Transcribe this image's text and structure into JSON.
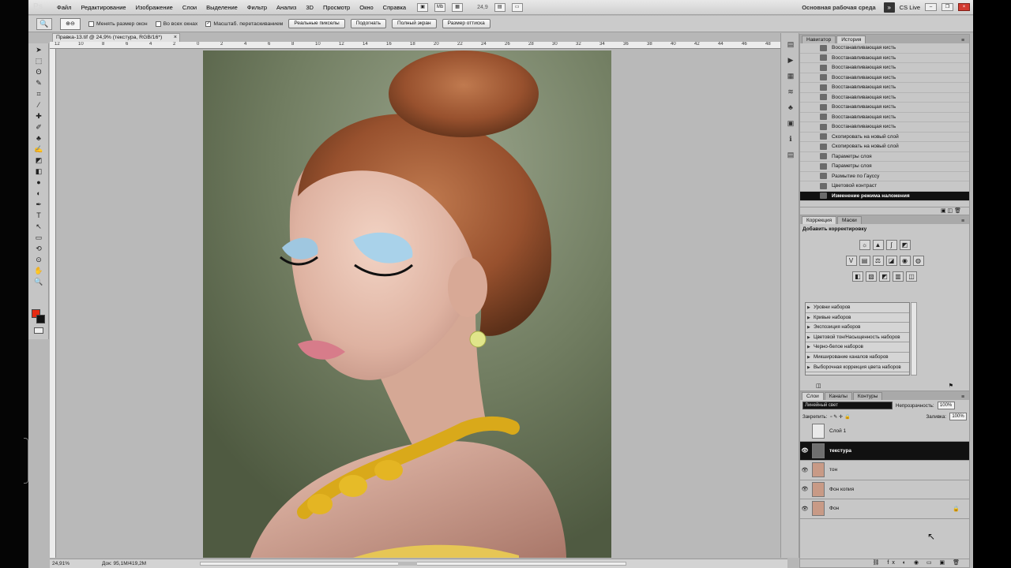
{
  "menubar": {
    "logo": "Ps",
    "items": [
      "Файл",
      "Редактирование",
      "Изображение",
      "Слои",
      "Выделение",
      "Фильтр",
      "Анализ",
      "3D",
      "Просмотр",
      "Окно",
      "Справка"
    ],
    "icons": [
      "mb-icon",
      "mb-icon"
    ],
    "zoom": "24,9",
    "workspace": "Основная рабочая среда",
    "workspace_btn": "»",
    "cs_live": "CS Live"
  },
  "options": {
    "tool_icon": "🔍",
    "zoom_icon": "⊕⊖",
    "checkboxes": [
      {
        "label": "Менять размер окон",
        "checked": false
      },
      {
        "label": "Во всех окнах",
        "checked": false
      },
      {
        "label": "Масштаб. перетаскиванием",
        "checked": true
      }
    ],
    "buttons": [
      "Реальные пикселы",
      "Подогнать",
      "Полный экран",
      "Размер оттиска"
    ]
  },
  "document": {
    "tab_title": "Правка-13.tif @ 24,9% (текстура, RGB/16*)",
    "tab_close": "×",
    "ruler_ticks": [
      "12",
      "10",
      "8",
      "6",
      "4",
      "2",
      "0",
      "2",
      "4",
      "6",
      "8",
      "10",
      "12",
      "14",
      "16",
      "18",
      "20",
      "22",
      "24",
      "26",
      "28",
      "30",
      "32",
      "34",
      "36",
      "38",
      "40",
      "42",
      "44",
      "46",
      "48"
    ]
  },
  "status": {
    "zoom": "24,91%",
    "doc": "Док: 95,1M/419,2M"
  },
  "history": {
    "tabs": [
      "Навигатор",
      "История"
    ],
    "rows": [
      "Восстанавливающая кисть",
      "Восстанавливающая кисть",
      "Восстанавливающая кисть",
      "Восстанавливающая кисть",
      "Восстанавливающая кисть",
      "Восстанавливающая кисть",
      "Восстанавливающая кисть",
      "Восстанавливающая кисть",
      "Восстанавливающая кисть",
      "Скопировать на новый слой",
      "Скопировать на новый слой",
      "Параметры слоя",
      "Параметры слоя",
      "Размытие по Гауссу",
      "Цветовой контраст",
      "Изменение режима наложения"
    ]
  },
  "adjustments": {
    "tabs": [
      "Коррекция",
      "Маски"
    ],
    "title": "Добавить корректировку",
    "presets": [
      "Уровни наборов",
      "Кривые наборов",
      "Экспозиция наборов",
      "Цветовой тон/Насыщенность наборов",
      "Черно-белое наборов",
      "Микширование каналов наборов",
      "Выборочная коррекция цвета наборов"
    ]
  },
  "layers": {
    "tabs": [
      "Слои",
      "Каналы",
      "Контуры"
    ],
    "blend_mode": "Линейный свет",
    "opacity_label": "Непрозрачность:",
    "opacity": "100%",
    "lock_label": "Закрепить:",
    "fill_label": "Заливка:",
    "fill": "100%",
    "items": [
      {
        "name": "Слой 1",
        "visible": false,
        "selected": false
      },
      {
        "name": "текстура",
        "visible": true,
        "selected": true
      },
      {
        "name": "тон",
        "visible": true,
        "selected": false
      },
      {
        "name": "Фон копия",
        "visible": true,
        "selected": false
      },
      {
        "name": "Фон",
        "visible": true,
        "selected": false,
        "locked": true
      }
    ]
  },
  "colors": {
    "foreground": "#e62a12",
    "background": "#111111"
  }
}
